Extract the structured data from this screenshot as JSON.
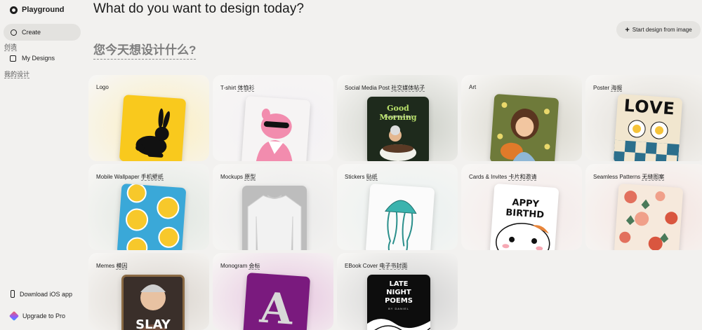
{
  "app": {
    "name": "Playground"
  },
  "sidebar": {
    "create_label": "Create",
    "create_sub": "创造",
    "mydesigns_label": "My Designs",
    "mydesigns_sub": "我的设计",
    "download_label": "Download iOS app",
    "upgrade_label": "Upgrade to Pro"
  },
  "header": {
    "title": "What do you want to design today?",
    "subtitle": "您今天想设计什么?",
    "start_button": "Start design from image",
    "start_button_icon": "plus-icon"
  },
  "cards": [
    {
      "label": "Logo",
      "label_cn": "",
      "bg": "#fbeec0"
    },
    {
      "label": "T-shirt",
      "label_cn": "体恤衫",
      "bg": "#f3f0f5"
    },
    {
      "label": "Social Media Post",
      "label_cn": "社交媒体帖子",
      "bg": "#c9ccc4"
    },
    {
      "label": "Art",
      "label_cn": "",
      "bg": "#d5d3c8"
    },
    {
      "label": "Poster",
      "label_cn": "海报",
      "bg": "#e0dcd5"
    },
    {
      "label": "Mobile Wallpaper",
      "label_cn": "手机壁纸",
      "bg": "#dee5df"
    },
    {
      "label": "Mockups",
      "label_cn": "原型",
      "bg": "#e9e9e9"
    },
    {
      "label": "Stickers",
      "label_cn": "贴纸",
      "bg": "#e9f0ef"
    },
    {
      "label": "Cards & Invites",
      "label_cn": "卡片和邀请",
      "bg": "#f4e9e8"
    },
    {
      "label": "Seamless Patterns",
      "label_cn": "无缝图案",
      "bg": "#f4e3df"
    },
    {
      "label": "Memes",
      "label_cn": "模因",
      "bg": "#d9d3cc"
    },
    {
      "label": "Monogram",
      "label_cn": "会标",
      "bg": "#e6c4df"
    },
    {
      "label": "EBook Cover",
      "label_cn": "电子书封面",
      "bg": "#cfcfcf"
    }
  ],
  "thumbs": {
    "social_title": "Good Morning",
    "social_sub": "It's a glorious day!",
    "poster_text": "LOVE",
    "cards_text": "APPY BIRTHD",
    "memes_text": "SLAY",
    "monogram_letter": "A",
    "ebook_line1": "LATE",
    "ebook_line2": "NIGHT",
    "ebook_line3": "POEMS",
    "ebook_author": "BY DANIEL"
  }
}
